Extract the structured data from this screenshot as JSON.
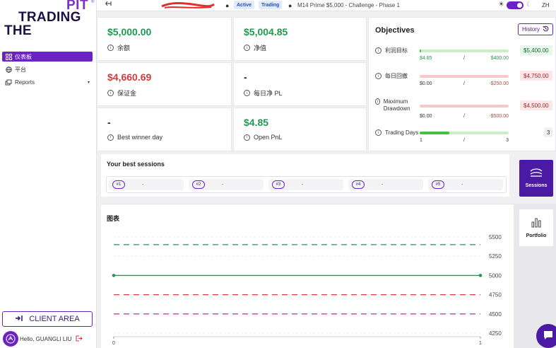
{
  "brand": {
    "line1": "PIT",
    "registered": "®",
    "line2": "TRADING",
    "line3": "THE"
  },
  "sidebar": {
    "items": [
      {
        "label": "仪表板",
        "icon": "grid-icon",
        "active": true
      },
      {
        "label": "平台",
        "icon": "globe-icon"
      },
      {
        "label": "Reports",
        "icon": "reports-icon",
        "caret": "▾"
      }
    ],
    "client_area": "CLIENT AREA",
    "hello": "Hello, GUANGLI LIU"
  },
  "topbar": {
    "status_active": "Active",
    "status_trading": "Trading",
    "account_name": "M14 Prime $5,000 - Challenge - Phase 1",
    "language": "ZH"
  },
  "cards": {
    "balance": {
      "value": "$5,000.00",
      "label": "余额"
    },
    "equity": {
      "value": "$5,004.85",
      "label": "净值"
    },
    "margin": {
      "value": "$4,660.69",
      "label": "保证金"
    },
    "daily_pl": {
      "value": "-",
      "label": "每日净 PL"
    },
    "best_winner": {
      "value": "-",
      "label": "Best winner day"
    },
    "open_pnl": {
      "value": "$4.85",
      "label": "Open PnL"
    }
  },
  "objectives": {
    "title": "Objectives",
    "history_label": "History",
    "rows": [
      {
        "name": "利润目标",
        "lo": "$4.85",
        "slash": "/",
        "hi": "$400.00",
        "target": "$5,400.00",
        "progress": 0.012
      },
      {
        "name": "每日回撤",
        "lo": "$0.00",
        "slash": "/",
        "hi": "-$250.00",
        "target": "$4,750.00",
        "progress": 0
      },
      {
        "name": "Maximum Drawdown",
        "lo": "$0.00",
        "slash": "/",
        "hi": "-$500.00",
        "target": "$4,500.00",
        "progress": 0
      },
      {
        "name": "Trading Days",
        "lo": "1",
        "slash": "/",
        "hi": "3",
        "target": "3",
        "progress": 0.333
      }
    ]
  },
  "sessions": {
    "title": "Your best sessions",
    "items": [
      {
        "num": "#1",
        "value": "-"
      },
      {
        "num": "#2",
        "value": "-"
      },
      {
        "num": "#3",
        "value": "-"
      },
      {
        "num": "#4",
        "value": "-"
      },
      {
        "num": "#5",
        "value": "-"
      }
    ],
    "sessions_button": "Sessions",
    "portfolio_button": "Portfolio"
  },
  "chart_data": {
    "type": "line",
    "title": "图表",
    "x_ticks": [
      "0",
      "1"
    ],
    "y_ticks": [
      "5500",
      "5250",
      "5000",
      "4750",
      "4500",
      "4250"
    ],
    "ylim": [
      4250,
      5500
    ],
    "xlim": [
      0,
      1
    ],
    "series": [
      {
        "values": [
          5000,
          5000
        ],
        "x": [
          0,
          1
        ],
        "color": "#1e9a50",
        "style": "solid"
      }
    ],
    "reference_lines": [
      {
        "y": 5400,
        "color": "#1e9a50",
        "style": "dashed"
      },
      {
        "y": 4750,
        "color": "#e03c3c",
        "style": "dashed"
      },
      {
        "y": 4500,
        "color": "#d43a9a",
        "style": "dashed"
      }
    ]
  }
}
